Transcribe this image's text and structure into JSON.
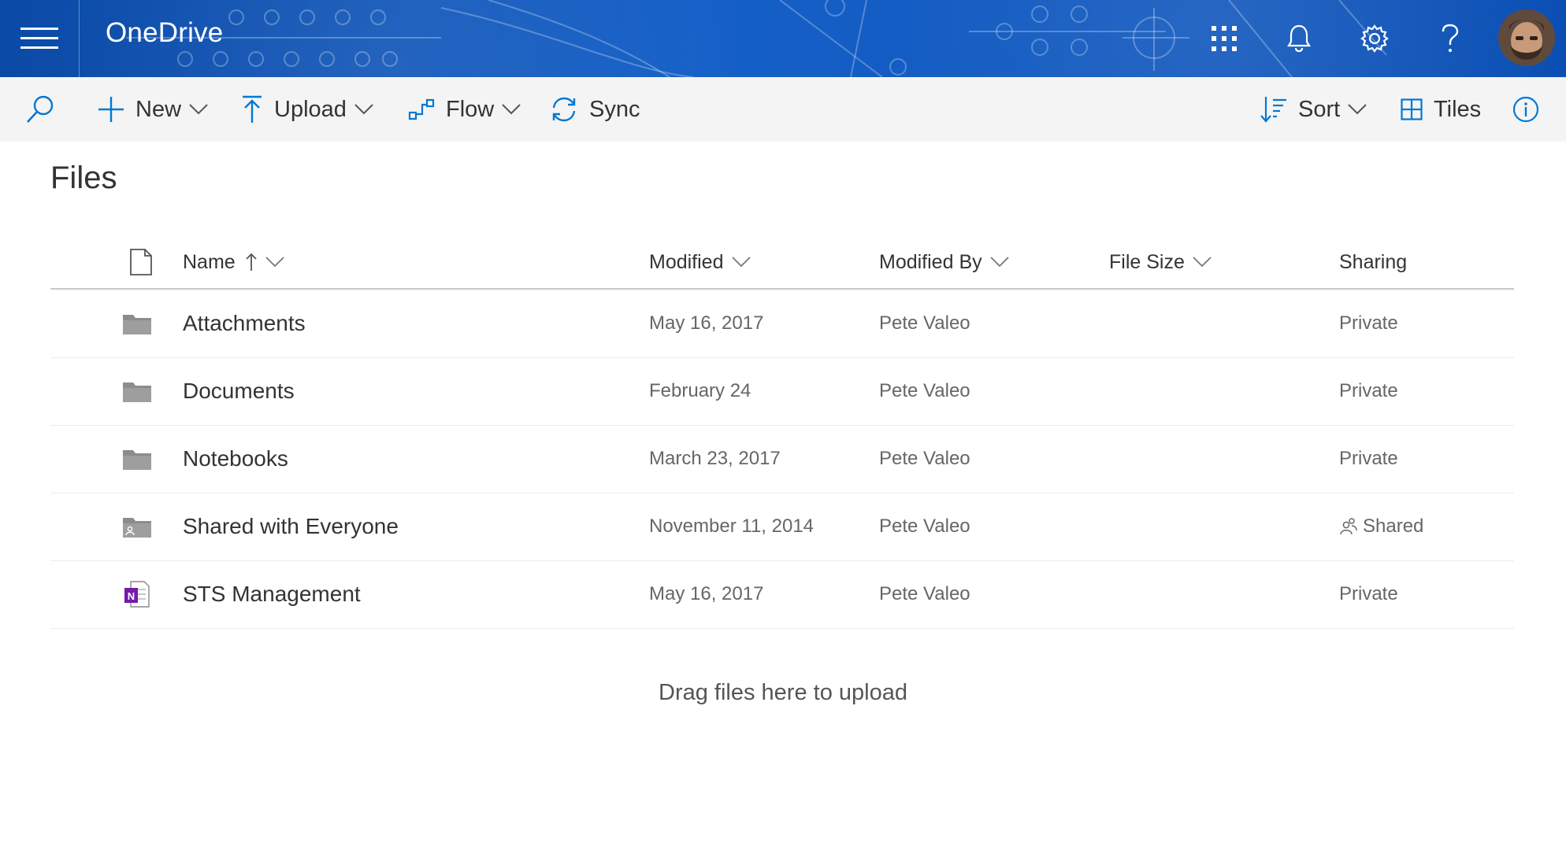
{
  "app": {
    "title": "OneDrive"
  },
  "colors": {
    "header_bg": "#0a4fb0",
    "accent": "#0078d4",
    "onenote": "#7719aa",
    "folder": "#8c8c8c"
  },
  "header": {
    "icons": [
      "app-launcher-icon",
      "bell-icon",
      "gear-icon",
      "help-icon"
    ]
  },
  "toolbar": {
    "new_label": "New",
    "upload_label": "Upload",
    "flow_label": "Flow",
    "sync_label": "Sync",
    "sort_label": "Sort",
    "view_label": "Tiles"
  },
  "main": {
    "title": "Files",
    "columns": {
      "name": "Name",
      "modified": "Modified",
      "modified_by": "Modified By",
      "file_size": "File Size",
      "sharing": "Sharing"
    },
    "rows": [
      {
        "name": "Attachments",
        "icon": "folder-icon",
        "modified": "May 16, 2017",
        "modified_by": "Pete Valeo",
        "file_size": "",
        "sharing": "Private"
      },
      {
        "name": "Documents",
        "icon": "folder-icon",
        "modified": "February 24",
        "modified_by": "Pete Valeo",
        "file_size": "",
        "sharing": "Private"
      },
      {
        "name": "Notebooks",
        "icon": "folder-icon",
        "modified": "March 23, 2017",
        "modified_by": "Pete Valeo",
        "file_size": "",
        "sharing": "Private"
      },
      {
        "name": "Shared with Everyone",
        "icon": "shared-folder-icon",
        "modified": "November 11, 2014",
        "modified_by": "Pete Valeo",
        "file_size": "",
        "sharing": "Shared"
      },
      {
        "name": "STS Management",
        "icon": "onenote-icon",
        "modified": "May 16, 2017",
        "modified_by": "Pete Valeo",
        "file_size": "",
        "sharing": "Private"
      }
    ],
    "drop_message": "Drag files here to upload"
  }
}
